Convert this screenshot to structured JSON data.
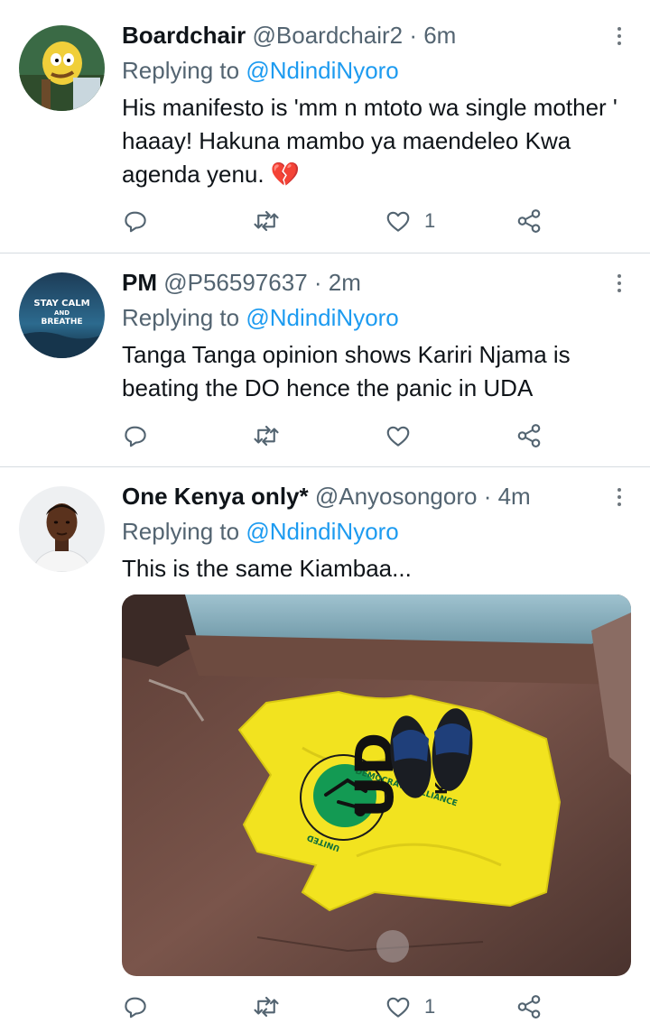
{
  "tweets": [
    {
      "name": "Boardchair",
      "handle": "@Boardchair2",
      "time": "· 6m",
      "replying_prefix": "Replying to",
      "replying_handle": "@NdindiNyoro",
      "text": "His manifesto  is 'mm n mtoto wa single mother '  haaay!  Hakuna mambo ya maendeleo Kwa agenda yenu. 💔",
      "reply_count": "",
      "retweet_count": "",
      "like_count": "1"
    },
    {
      "name": "PM",
      "handle": "@P56597637",
      "time": "· 2m",
      "replying_prefix": "Replying to",
      "replying_handle": "@NdindiNyoro",
      "text": "Tanga Tanga opinion shows Kariri Njama is beating the DO hence the panic in UDA",
      "avatar_text": [
        "STAY CALM",
        "AND",
        "BREATHE"
      ],
      "reply_count": "",
      "retweet_count": "",
      "like_count": ""
    },
    {
      "name": "One Kenya only*",
      "handle": "@Anyosongoro",
      "time": "· 4m",
      "replying_prefix": "Replying to",
      "replying_handle": "@NdindiNyoro",
      "text": "This is the same Kiambaa...",
      "media_text": {
        "arc_top": "DEMOCRATIC ALLIANCE",
        "arc_bottom": "UNITED",
        "letters": "UD",
        "slogan": "KAZI N"
      },
      "reply_count": "",
      "retweet_count": "",
      "like_count": "1"
    }
  ],
  "colors": {
    "link": "#1d9bf0",
    "secondary_text": "#536471",
    "icon": "#536471",
    "divider": "#d6dce1",
    "shirt_yellow": "#f2e31f"
  },
  "icons": [
    "reply-icon",
    "retweet-icon",
    "like-icon",
    "share-icon",
    "more-icon",
    "broken-heart-emoji"
  ]
}
